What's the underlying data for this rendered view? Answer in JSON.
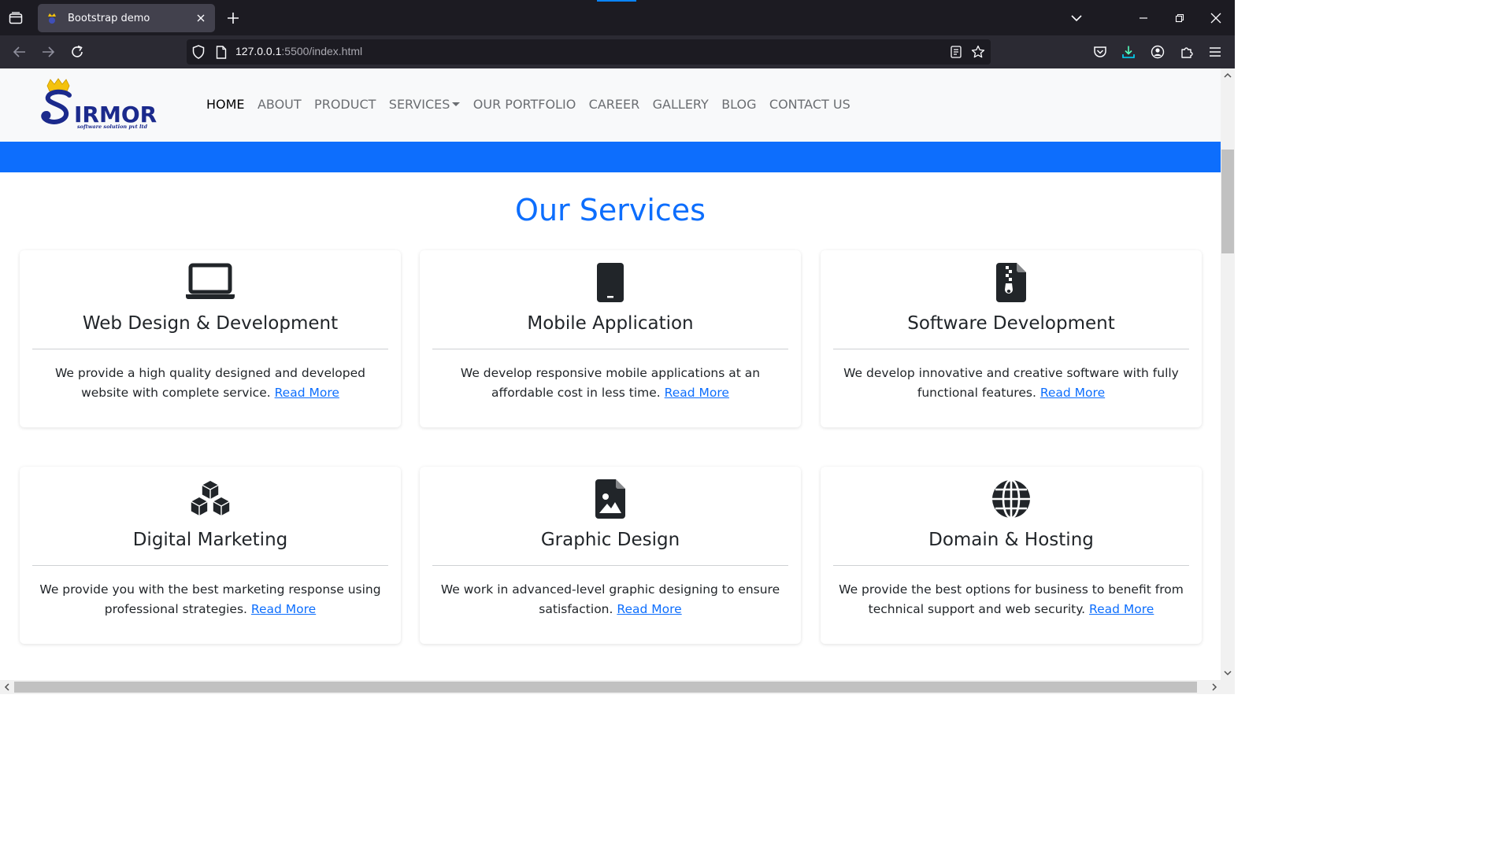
{
  "browser": {
    "tab_title": "Bootstrap demo",
    "url_host": "127.0.0.1",
    "url_rest": ":5500/index.html"
  },
  "site": {
    "logo_text": "IRMOR",
    "logo_initial": "S",
    "logo_sub": "software solution pvt ltd",
    "nav": [
      {
        "label": "HOME"
      },
      {
        "label": "ABOUT"
      },
      {
        "label": "PRODUCT"
      },
      {
        "label": "SERVICES"
      },
      {
        "label": "OUR PORTFOLIO"
      },
      {
        "label": "CAREER"
      },
      {
        "label": "GALLERY"
      },
      {
        "label": "BLOG"
      },
      {
        "label": "CONTACT US"
      }
    ],
    "accent_color": "#0d6efd"
  },
  "services": {
    "title": "Our Services",
    "read_more": "Read More",
    "cards": [
      {
        "icon": "laptop-icon",
        "title": "Web Design & Development",
        "text": "We provide a high quality designed and developed website with complete service."
      },
      {
        "icon": "phone-icon",
        "title": "Mobile Application",
        "text": "We develop responsive mobile applications at an affordable cost in less time."
      },
      {
        "icon": "file-zip-icon",
        "title": "Software Development",
        "text": "We develop innovative and creative software with fully functional features."
      },
      {
        "icon": "boxes-icon",
        "title": "Digital Marketing",
        "text": "We provide you with the best marketing response using professional strategies."
      },
      {
        "icon": "file-image-icon",
        "title": "Graphic Design",
        "text": "We work in advanced-level graphic designing to ensure satisfaction."
      },
      {
        "icon": "globe-icon",
        "title": "Domain & Hosting",
        "text": "We provide the best options for business to benefit from technical support and web security."
      }
    ]
  }
}
